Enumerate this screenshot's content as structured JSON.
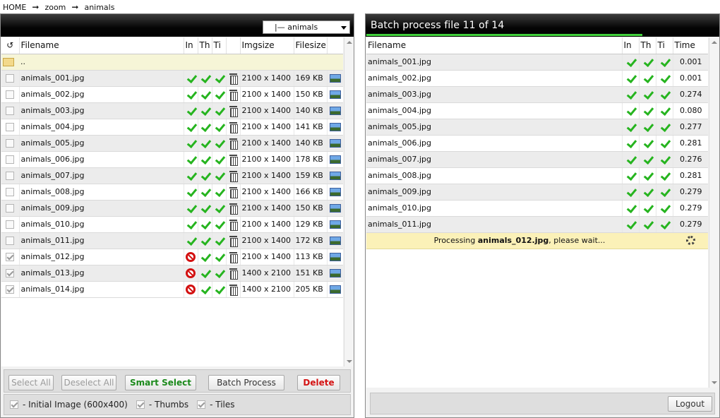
{
  "breadcrumb": [
    "HOME",
    "zoom",
    "animals"
  ],
  "left": {
    "folder_select": "|— animals",
    "columns": [
      "Filename",
      "In",
      "Th",
      "Ti",
      "Imgsize",
      "Filesize"
    ],
    "up_label": "..",
    "rows": [
      {
        "name": "animals_001.jpg",
        "checked": false,
        "in": true,
        "imgsize": "2100 x 1400",
        "filesize": "169 KB"
      },
      {
        "name": "animals_002.jpg",
        "checked": false,
        "in": true,
        "imgsize": "2100 x 1400",
        "filesize": "150 KB"
      },
      {
        "name": "animals_003.jpg",
        "checked": false,
        "in": true,
        "imgsize": "2100 x 1400",
        "filesize": "140 KB"
      },
      {
        "name": "animals_004.jpg",
        "checked": false,
        "in": true,
        "imgsize": "2100 x 1400",
        "filesize": "141 KB"
      },
      {
        "name": "animals_005.jpg",
        "checked": false,
        "in": true,
        "imgsize": "2100 x 1400",
        "filesize": "140 KB"
      },
      {
        "name": "animals_006.jpg",
        "checked": false,
        "in": true,
        "imgsize": "2100 x 1400",
        "filesize": "178 KB"
      },
      {
        "name": "animals_007.jpg",
        "checked": false,
        "in": true,
        "imgsize": "2100 x 1400",
        "filesize": "159 KB"
      },
      {
        "name": "animals_008.jpg",
        "checked": false,
        "in": true,
        "imgsize": "2100 x 1400",
        "filesize": "166 KB"
      },
      {
        "name": "animals_009.jpg",
        "checked": false,
        "in": true,
        "imgsize": "2100 x 1400",
        "filesize": "150 KB"
      },
      {
        "name": "animals_010.jpg",
        "checked": false,
        "in": true,
        "imgsize": "2100 x 1400",
        "filesize": "129 KB"
      },
      {
        "name": "animals_011.jpg",
        "checked": false,
        "in": true,
        "imgsize": "2100 x 1400",
        "filesize": "172 KB"
      },
      {
        "name": "animals_012.jpg",
        "checked": true,
        "in": false,
        "imgsize": "2100 x 1400",
        "filesize": "113 KB"
      },
      {
        "name": "animals_013.jpg",
        "checked": true,
        "in": false,
        "imgsize": "1400 x 2100",
        "filesize": "151 KB"
      },
      {
        "name": "animals_014.jpg",
        "checked": true,
        "in": false,
        "imgsize": "1400 x 2100",
        "filesize": "205 KB"
      }
    ],
    "buttons": {
      "select_all": "Select All",
      "deselect_all": "Deselect All",
      "smart_select": "Smart Select",
      "batch_process": "Batch Process",
      "delete": "Delete"
    },
    "options": {
      "initial": "- Initial Image (600x400)",
      "thumbs": "- Thumbs",
      "tiles": "- Tiles"
    }
  },
  "right": {
    "title": "Batch process file 11 of 14",
    "progress": 0.786,
    "columns": [
      "Filename",
      "In",
      "Th",
      "Ti",
      "Time"
    ],
    "rows": [
      {
        "name": "animals_001.jpg",
        "time": "0.001"
      },
      {
        "name": "animals_002.jpg",
        "time": "0.001"
      },
      {
        "name": "animals_003.jpg",
        "time": "0.274"
      },
      {
        "name": "animals_004.jpg",
        "time": "0.080"
      },
      {
        "name": "animals_005.jpg",
        "time": "0.277"
      },
      {
        "name": "animals_006.jpg",
        "time": "0.281"
      },
      {
        "name": "animals_007.jpg",
        "time": "0.276"
      },
      {
        "name": "animals_008.jpg",
        "time": "0.281"
      },
      {
        "name": "animals_009.jpg",
        "time": "0.279"
      },
      {
        "name": "animals_010.jpg",
        "time": "0.279"
      },
      {
        "name": "animals_011.jpg",
        "time": "0.279"
      }
    ],
    "processing": {
      "prefix": "Processing ",
      "file": "animals_012.jpg",
      "suffix": ", please wait..."
    },
    "logout": "Logout"
  },
  "colors": {
    "accent_green": "#42d13c",
    "check_green": "#26b41f",
    "stop_red": "#d31010",
    "delete_red": "#d41414",
    "smart_green": "#1c8a1c"
  },
  "icons": {
    "refresh": "refresh-icon",
    "folder": "folder-icon",
    "check": "check-icon",
    "stop": "no-entry-icon",
    "delete": "trash-icon",
    "preview": "image-preview-icon",
    "loading": "spinner-icon"
  }
}
